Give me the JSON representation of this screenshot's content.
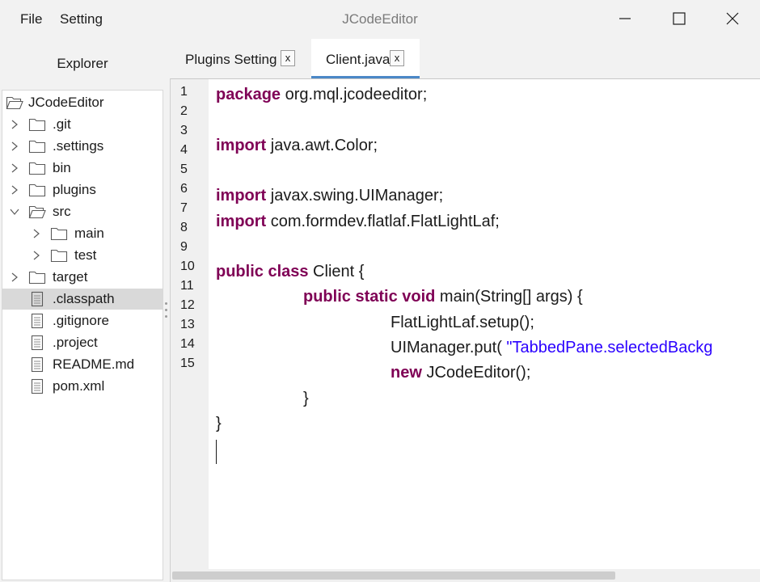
{
  "menu": {
    "file": "File",
    "setting": "Setting"
  },
  "window": {
    "title": "JCodeEditor",
    "controls": [
      "minimize-icon",
      "maximize-icon",
      "close-icon"
    ]
  },
  "explorer": {
    "title": "Explorer",
    "tree": [
      {
        "label": "JCodeEditor",
        "type": "folder-open",
        "depth": 0,
        "chevron": "none"
      },
      {
        "label": ".git",
        "type": "folder",
        "depth": 1,
        "chevron": "right"
      },
      {
        "label": ".settings",
        "type": "folder",
        "depth": 1,
        "chevron": "right"
      },
      {
        "label": "bin",
        "type": "folder",
        "depth": 1,
        "chevron": "right"
      },
      {
        "label": "plugins",
        "type": "folder",
        "depth": 1,
        "chevron": "right"
      },
      {
        "label": "src",
        "type": "folder-open",
        "depth": 1,
        "chevron": "down"
      },
      {
        "label": "main",
        "type": "folder",
        "depth": 2,
        "chevron": "right"
      },
      {
        "label": "test",
        "type": "folder",
        "depth": 2,
        "chevron": "right"
      },
      {
        "label": "target",
        "type": "folder",
        "depth": 1,
        "chevron": "right"
      },
      {
        "label": ".classpath",
        "type": "file",
        "depth": 1,
        "chevron": "none",
        "selected": true
      },
      {
        "label": ".gitignore",
        "type": "file",
        "depth": 1,
        "chevron": "none"
      },
      {
        "label": ".project",
        "type": "file",
        "depth": 1,
        "chevron": "none"
      },
      {
        "label": "README.md",
        "type": "file",
        "depth": 1,
        "chevron": "none"
      },
      {
        "label": "pom.xml",
        "type": "file",
        "depth": 1,
        "chevron": "none"
      }
    ]
  },
  "tabs": [
    {
      "label": "Plugins Setting",
      "close": "x",
      "active": false
    },
    {
      "label": "Client.java",
      "close": "x",
      "active": true
    }
  ],
  "editor": {
    "line_numbers": [
      "1",
      "2",
      "3",
      "4",
      "5",
      "6",
      "7",
      "8",
      "9",
      "10",
      "11",
      "12",
      "13",
      "14",
      "15"
    ],
    "lines": [
      [
        {
          "t": "package",
          "k": "kw"
        },
        {
          "t": " org.mql.jcodeeditor;",
          "k": ""
        }
      ],
      [],
      [
        {
          "t": "import",
          "k": "kw"
        },
        {
          "t": " java.awt.Color;",
          "k": ""
        }
      ],
      [],
      [
        {
          "t": "import",
          "k": "kw"
        },
        {
          "t": " javax.swing.UIManager;",
          "k": ""
        }
      ],
      [
        {
          "t": "import",
          "k": "kw"
        },
        {
          "t": " com.formdev.flatlaf.FlatLightLaf;",
          "k": ""
        }
      ],
      [],
      [
        {
          "t": "public class",
          "k": "kw"
        },
        {
          "t": " Client {",
          "k": ""
        }
      ],
      [
        {
          "t": "\t\t",
          "k": ""
        },
        {
          "t": "public static void",
          "k": "kw"
        },
        {
          "t": " main(String[] args) {",
          "k": ""
        }
      ],
      [
        {
          "t": "\t\t\t\t",
          "k": ""
        },
        {
          "t": "FlatLightLaf.setup();",
          "k": ""
        }
      ],
      [
        {
          "t": "\t\t\t\t",
          "k": ""
        },
        {
          "t": "UIManager.put( ",
          "k": ""
        },
        {
          "t": "\"TabbedPane.selectedBackg",
          "k": "str"
        }
      ],
      [
        {
          "t": "\t\t\t\t",
          "k": ""
        },
        {
          "t": "new",
          "k": "kw"
        },
        {
          "t": " JCodeEditor();",
          "k": ""
        }
      ],
      [
        {
          "t": "\t\t",
          "k": ""
        },
        {
          "t": "}",
          "k": ""
        }
      ],
      [
        {
          "t": "}",
          "k": ""
        }
      ]
    ]
  },
  "colors": {
    "keyword": "#7f0055",
    "string": "#2a00ff",
    "active_tab_underline": "#4b88c7"
  }
}
